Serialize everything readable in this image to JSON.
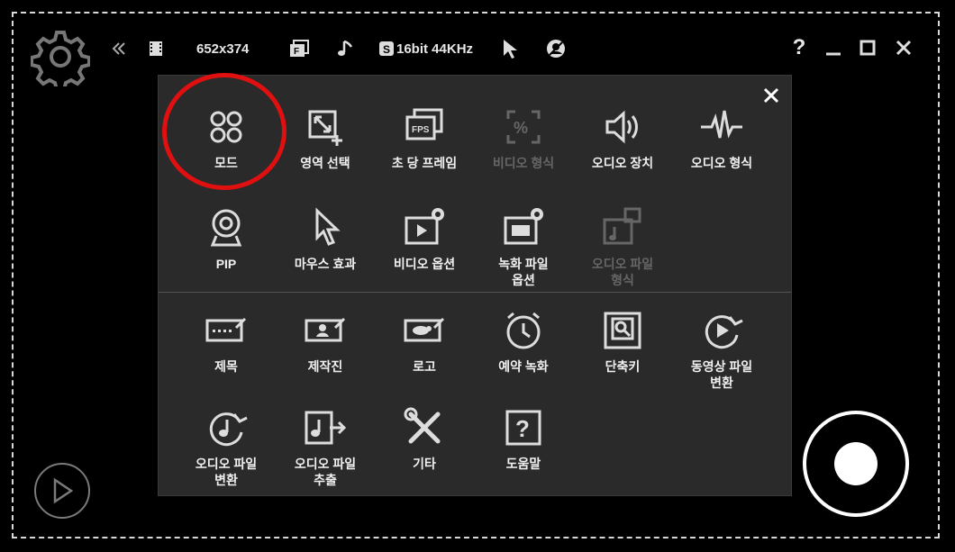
{
  "toolbar": {
    "resolution": "652x374",
    "audio_format": "16bit 44KHz",
    "help": "?"
  },
  "menu": {
    "items": [
      {
        "label": "모드",
        "icon": "mode-icon",
        "enabled": true
      },
      {
        "label": "영역 선택",
        "icon": "area-select-icon",
        "enabled": true
      },
      {
        "label": "초 당 프레임",
        "icon": "fps-icon",
        "enabled": true
      },
      {
        "label": "비디오 형식",
        "icon": "video-format-icon",
        "enabled": false
      },
      {
        "label": "오디오 장치",
        "icon": "audio-device-icon",
        "enabled": true
      },
      {
        "label": "오디오 형식",
        "icon": "audio-format-icon",
        "enabled": true
      },
      {
        "label": "PIP",
        "icon": "webcam-icon",
        "enabled": true
      },
      {
        "label": "마우스 효과",
        "icon": "cursor-icon",
        "enabled": true
      },
      {
        "label": "비디오 옵션",
        "icon": "video-options-icon",
        "enabled": true
      },
      {
        "label": "녹화 파일\n옵션",
        "icon": "record-file-options-icon",
        "enabled": true
      },
      {
        "label": "오디오 파일\n형식",
        "icon": "audio-file-format-icon",
        "enabled": false
      },
      {
        "label": "제목",
        "icon": "title-icon",
        "enabled": true
      },
      {
        "label": "제작진",
        "icon": "credits-icon",
        "enabled": true
      },
      {
        "label": "로고",
        "icon": "logo-icon",
        "enabled": true
      },
      {
        "label": "예약 녹화",
        "icon": "schedule-icon",
        "enabled": true
      },
      {
        "label": "단축키",
        "icon": "hotkey-icon",
        "enabled": true
      },
      {
        "label": "동영상 파일\n변환",
        "icon": "video-convert-icon",
        "enabled": true
      },
      {
        "label": "오디오 파일\n변환",
        "icon": "audio-convert-icon",
        "enabled": true
      },
      {
        "label": "오디오 파일\n추출",
        "icon": "audio-extract-icon",
        "enabled": true
      },
      {
        "label": "기타",
        "icon": "tools-icon",
        "enabled": true
      },
      {
        "label": "도움말",
        "icon": "help-icon",
        "enabled": true
      }
    ]
  },
  "colors": {
    "panel_bg": "#2a2a2a",
    "highlight_ring": "#e01010",
    "disabled_text": "#666666"
  }
}
